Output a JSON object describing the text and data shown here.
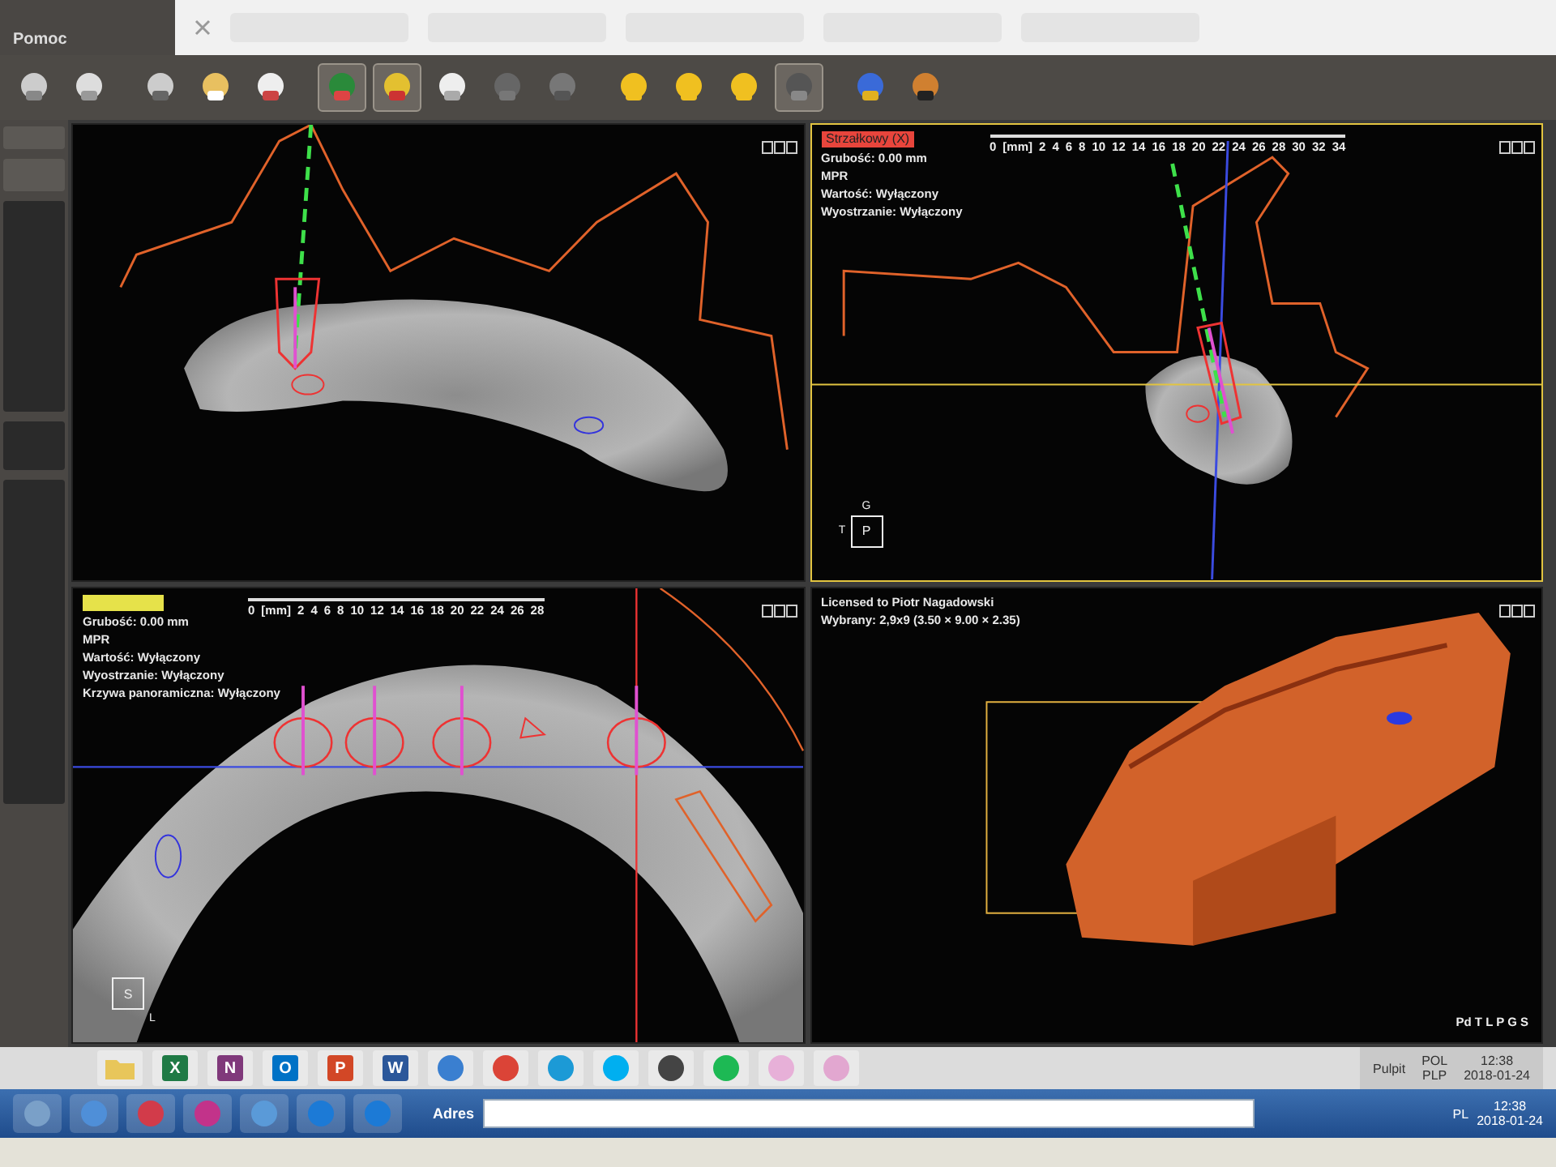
{
  "menu": {
    "items": [
      {
        "label": "Pomoc"
      }
    ]
  },
  "toolbar": {
    "buttons": [
      {
        "pressed": false
      },
      {
        "pressed": false
      },
      {
        "pressed": false
      },
      {
        "pressed": false
      },
      {
        "pressed": false
      },
      {
        "pressed": true
      },
      {
        "pressed": true
      },
      {
        "pressed": false
      },
      {
        "pressed": false
      },
      {
        "pressed": false
      },
      {
        "pressed": false
      },
      {
        "pressed": false
      },
      {
        "pressed": false
      },
      {
        "pressed": true
      },
      {
        "pressed": false
      },
      {
        "pressed": false
      }
    ]
  },
  "panes": [
    {
      "kind": "axial",
      "selected": false
    },
    {
      "kind": "sagittal",
      "selected": true,
      "header": {
        "text": "Strzałkowy (X)",
        "color": "#e8453c"
      },
      "info": [
        "Grubość: 0.00 mm",
        "MPR",
        "Wartość: Wyłączony",
        "Wyostrzanie: Wyłączony"
      ],
      "ruler": [
        "0",
        "[mm]",
        "2",
        "4",
        "6",
        "8",
        "10",
        "12",
        "14",
        "16",
        "18",
        "20",
        "22",
        "24",
        "26",
        "28",
        "30",
        "32",
        "34"
      ],
      "orientation": {
        "top": "G",
        "left": "T",
        "center": "P"
      }
    },
    {
      "kind": "panoramic",
      "selected": false,
      "header": {
        "color": "#e6e24a"
      },
      "info": [
        "Grubość: 0.00 mm",
        "MPR",
        "Wartość: Wyłączony",
        "Wyostrzanie: Wyłączony",
        "Krzywa panoramiczna: Wyłączony"
      ],
      "ruler": [
        "0",
        "[mm]",
        "2",
        "4",
        "6",
        "8",
        "10",
        "12",
        "14",
        "16",
        "18",
        "20",
        "22",
        "24",
        "26",
        "28"
      ],
      "orientation": {
        "center": "S",
        "right": "L"
      }
    },
    {
      "kind": "render3d",
      "selected": false,
      "info": [
        "Licensed to Piotr Nagadowski",
        "Wybrany: 2,9x9 (3.50 × 9.00 × 2.35)"
      ],
      "footer": "Pd T L P G S"
    }
  ],
  "quick_launch": {
    "apps": [
      {
        "kind": "folder",
        "color": "#e8c65a"
      },
      {
        "kind": "letter",
        "glyph": "X",
        "color": "#1f7a45"
      },
      {
        "kind": "letter",
        "glyph": "N",
        "color": "#80397b"
      },
      {
        "kind": "letter",
        "glyph": "O",
        "color": "#0072c6"
      },
      {
        "kind": "letter",
        "glyph": "P",
        "color": "#d24726"
      },
      {
        "kind": "letter",
        "glyph": "W",
        "color": "#2b579a"
      },
      {
        "kind": "round",
        "color": "#3a7fd0"
      },
      {
        "kind": "round",
        "color": "#db4437"
      },
      {
        "kind": "round",
        "color": "#1c9ad6"
      },
      {
        "kind": "round",
        "color": "#00aff0"
      },
      {
        "kind": "round",
        "color": "#444444"
      },
      {
        "kind": "round",
        "color": "#1db954"
      },
      {
        "kind": "round",
        "color": "#e7b0d8"
      },
      {
        "kind": "round",
        "color": "#e2a7d0"
      }
    ],
    "tray": {
      "label": "Pulpit",
      "lang": [
        "POL",
        "PLP"
      ],
      "time": "12:38",
      "date": "2018-01-24"
    }
  },
  "taskbar": {
    "apps": [
      {
        "color": "#7aa0c8"
      },
      {
        "color": "#4f8fd8"
      },
      {
        "color": "#d23b4a"
      },
      {
        "color": "#c2338a"
      },
      {
        "color": "#5a9ad8"
      },
      {
        "color": "#1c7ad6"
      },
      {
        "color": "#1c7ad6"
      }
    ],
    "address_label": "Adres",
    "lang": "PL",
    "time": "12:38",
    "date": "2018-01-24"
  }
}
